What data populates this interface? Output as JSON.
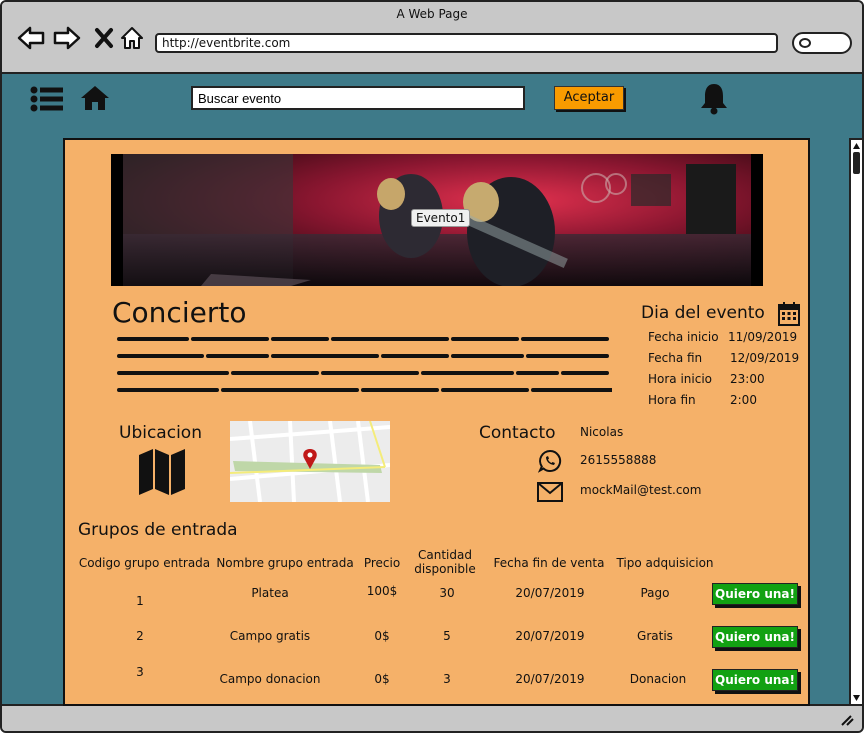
{
  "window": {
    "title": "A Web Page"
  },
  "browser": {
    "url": "http://eventbrite.com"
  },
  "toolbar": {
    "search_placeholder": "Buscar evento",
    "accept_label": "Aceptar"
  },
  "event": {
    "image_caption": "Evento1",
    "title": "Concierto"
  },
  "schedule": {
    "title": "Dia del evento",
    "rows": [
      {
        "label": "Fecha inicio",
        "value": "11/09/2019"
      },
      {
        "label": "Fecha fin",
        "value": "12/09/2019"
      },
      {
        "label": "Hora inicio",
        "value": "23:00"
      },
      {
        "label": "Hora fin",
        "value": "2:00"
      }
    ]
  },
  "location": {
    "title": "Ubicacion"
  },
  "contact": {
    "title": "Contacto",
    "name": "Nicolas",
    "phone": "2615558888",
    "email": "mockMail@test.com"
  },
  "groups": {
    "title": "Grupos de entrada",
    "headers": {
      "code": "Codigo grupo entrada",
      "name": "Nombre grupo entrada",
      "price": "Precio",
      "qty_line1": "Cantidad",
      "qty_line2": "disponible",
      "end": "Fecha fin de venta",
      "type": "Tipo adquisicion"
    },
    "rows": [
      {
        "code": "1",
        "name": "Platea",
        "price": "100$",
        "qty": "30",
        "end": "20/07/2019",
        "type": "Pago",
        "button": "Quiero una!"
      },
      {
        "code": "2",
        "name": "Campo gratis",
        "price": "0$",
        "qty": "5",
        "end": "20/07/2019",
        "type": "Gratis",
        "button": "Quiero una!"
      },
      {
        "code": "3",
        "name": "Campo donacion",
        "price": "0$",
        "qty": "3",
        "end": "20/07/2019",
        "type": "Donacion",
        "button": "Quiero una!"
      }
    ]
  },
  "colors": {
    "app_background": "#3e7a89",
    "card_background": "#f5b169",
    "accept_button": "#f99b00",
    "want_button": "#12a112"
  },
  "icons": [
    "back-arrow-icon",
    "forward-arrow-icon",
    "close-icon",
    "home-icon",
    "search-icon",
    "menu-list-icon",
    "bell-icon",
    "calendar-icon",
    "map-icon",
    "whatsapp-icon",
    "mail-icon",
    "map-pin-icon"
  ]
}
